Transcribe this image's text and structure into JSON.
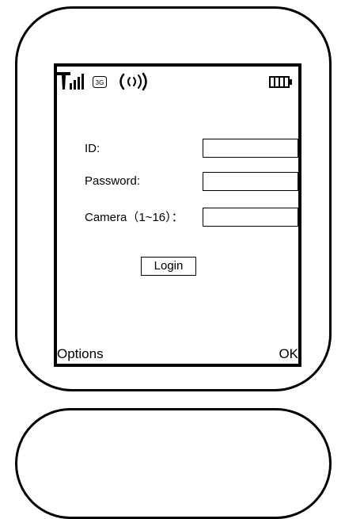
{
  "status_bar": {
    "icons": [
      "signal-strength-icon",
      "network-3g-icon",
      "wireless-icon",
      "battery-icon"
    ],
    "network_label": "3G"
  },
  "form": {
    "id_label": "ID:",
    "id_value": "",
    "password_label": "Password:",
    "password_value": "",
    "camera_label": "Camera（1~16）：",
    "camera_value": ""
  },
  "login_label": "Login",
  "softkeys": {
    "left": "Options",
    "right": "OK"
  }
}
